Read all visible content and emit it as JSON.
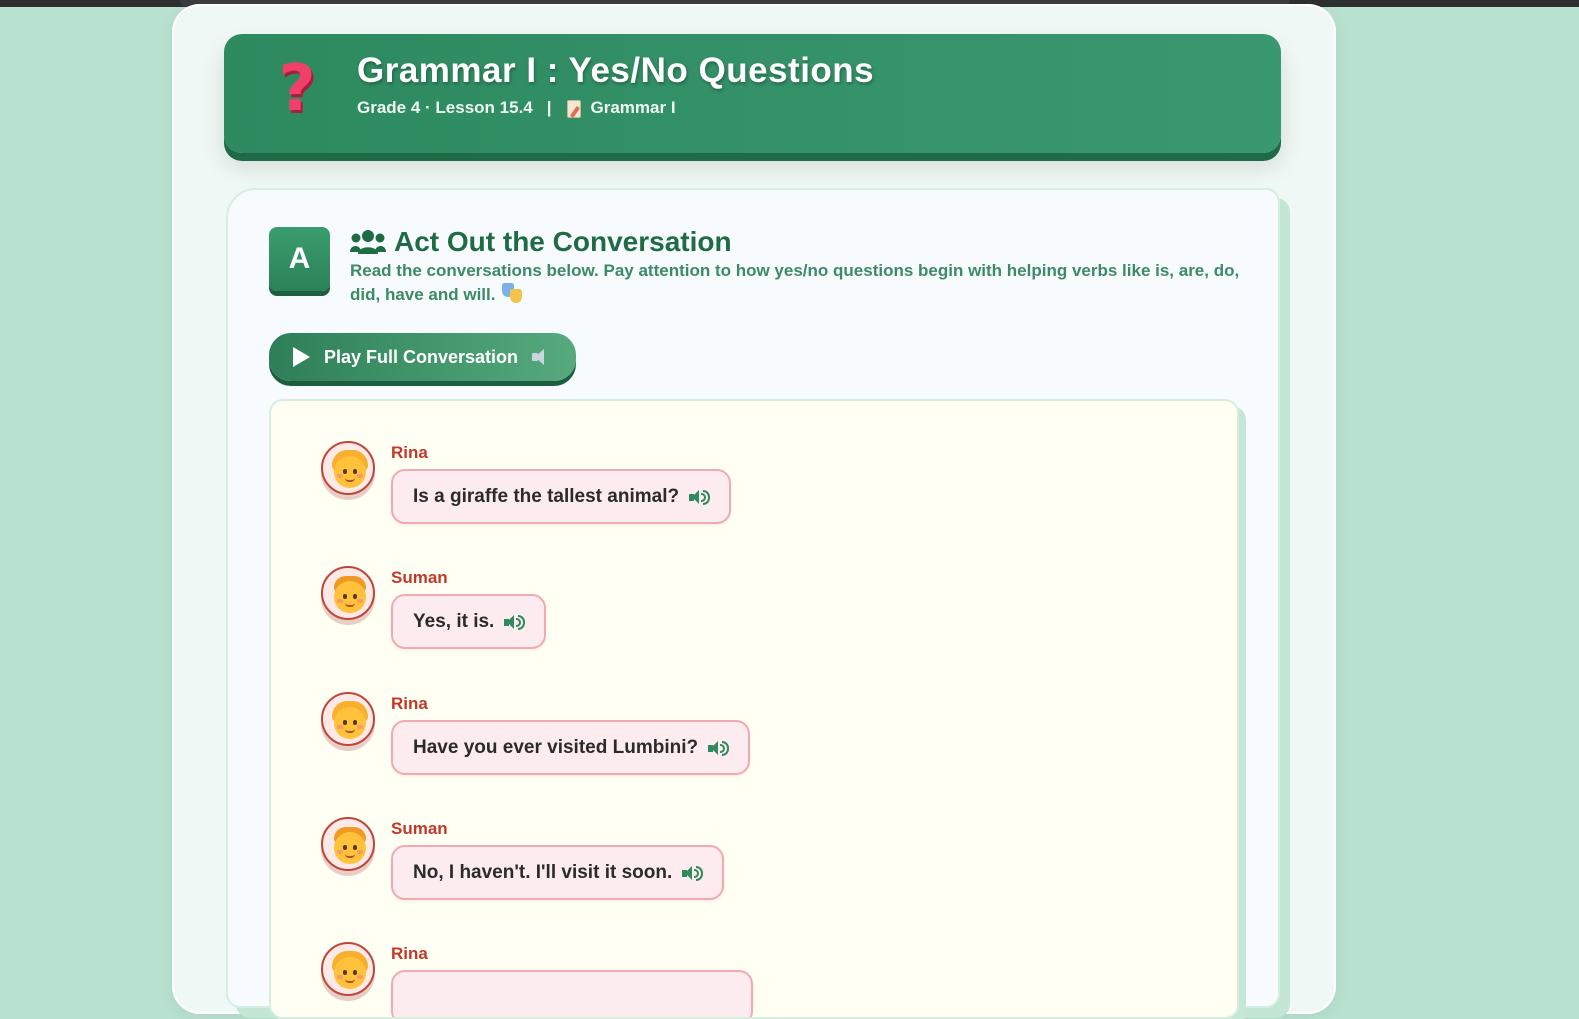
{
  "header": {
    "icon": "question-mark-icon",
    "title": "Grammar I : Yes/No Questions",
    "meta": "Grade 4 · Lesson 15.4",
    "separator": "|",
    "category": "Grammar I",
    "category_icon": "document-icon"
  },
  "section": {
    "badge": "A",
    "title_icon": "users-icon",
    "title": "Act Out the Conversation",
    "description": "Read the conversations below. Pay attention to how yes/no questions begin with helping verbs like is, are, do, did, have and will.",
    "description_icon": "theater-masks-icon",
    "play_button": "Play Full Conversation"
  },
  "conversation": [
    {
      "speaker": "Rina",
      "avatar": "girl",
      "text": "Is a giraffe the tallest animal?"
    },
    {
      "speaker": "Suman",
      "avatar": "boy",
      "text": "Yes, it is."
    },
    {
      "speaker": "Rina",
      "avatar": "girl",
      "text": "Have you ever visited Lumbini?"
    },
    {
      "speaker": "Suman",
      "avatar": "boy",
      "text": "No, I haven't. I'll visit it soon."
    },
    {
      "speaker": "Rina",
      "avatar": "girl",
      "text": ""
    }
  ],
  "colors": {
    "page_bg": "#b8e2cf",
    "header_green": "#2d8a5f",
    "speaker_red": "#c0392b",
    "bubble_pink": "#fdecef"
  }
}
